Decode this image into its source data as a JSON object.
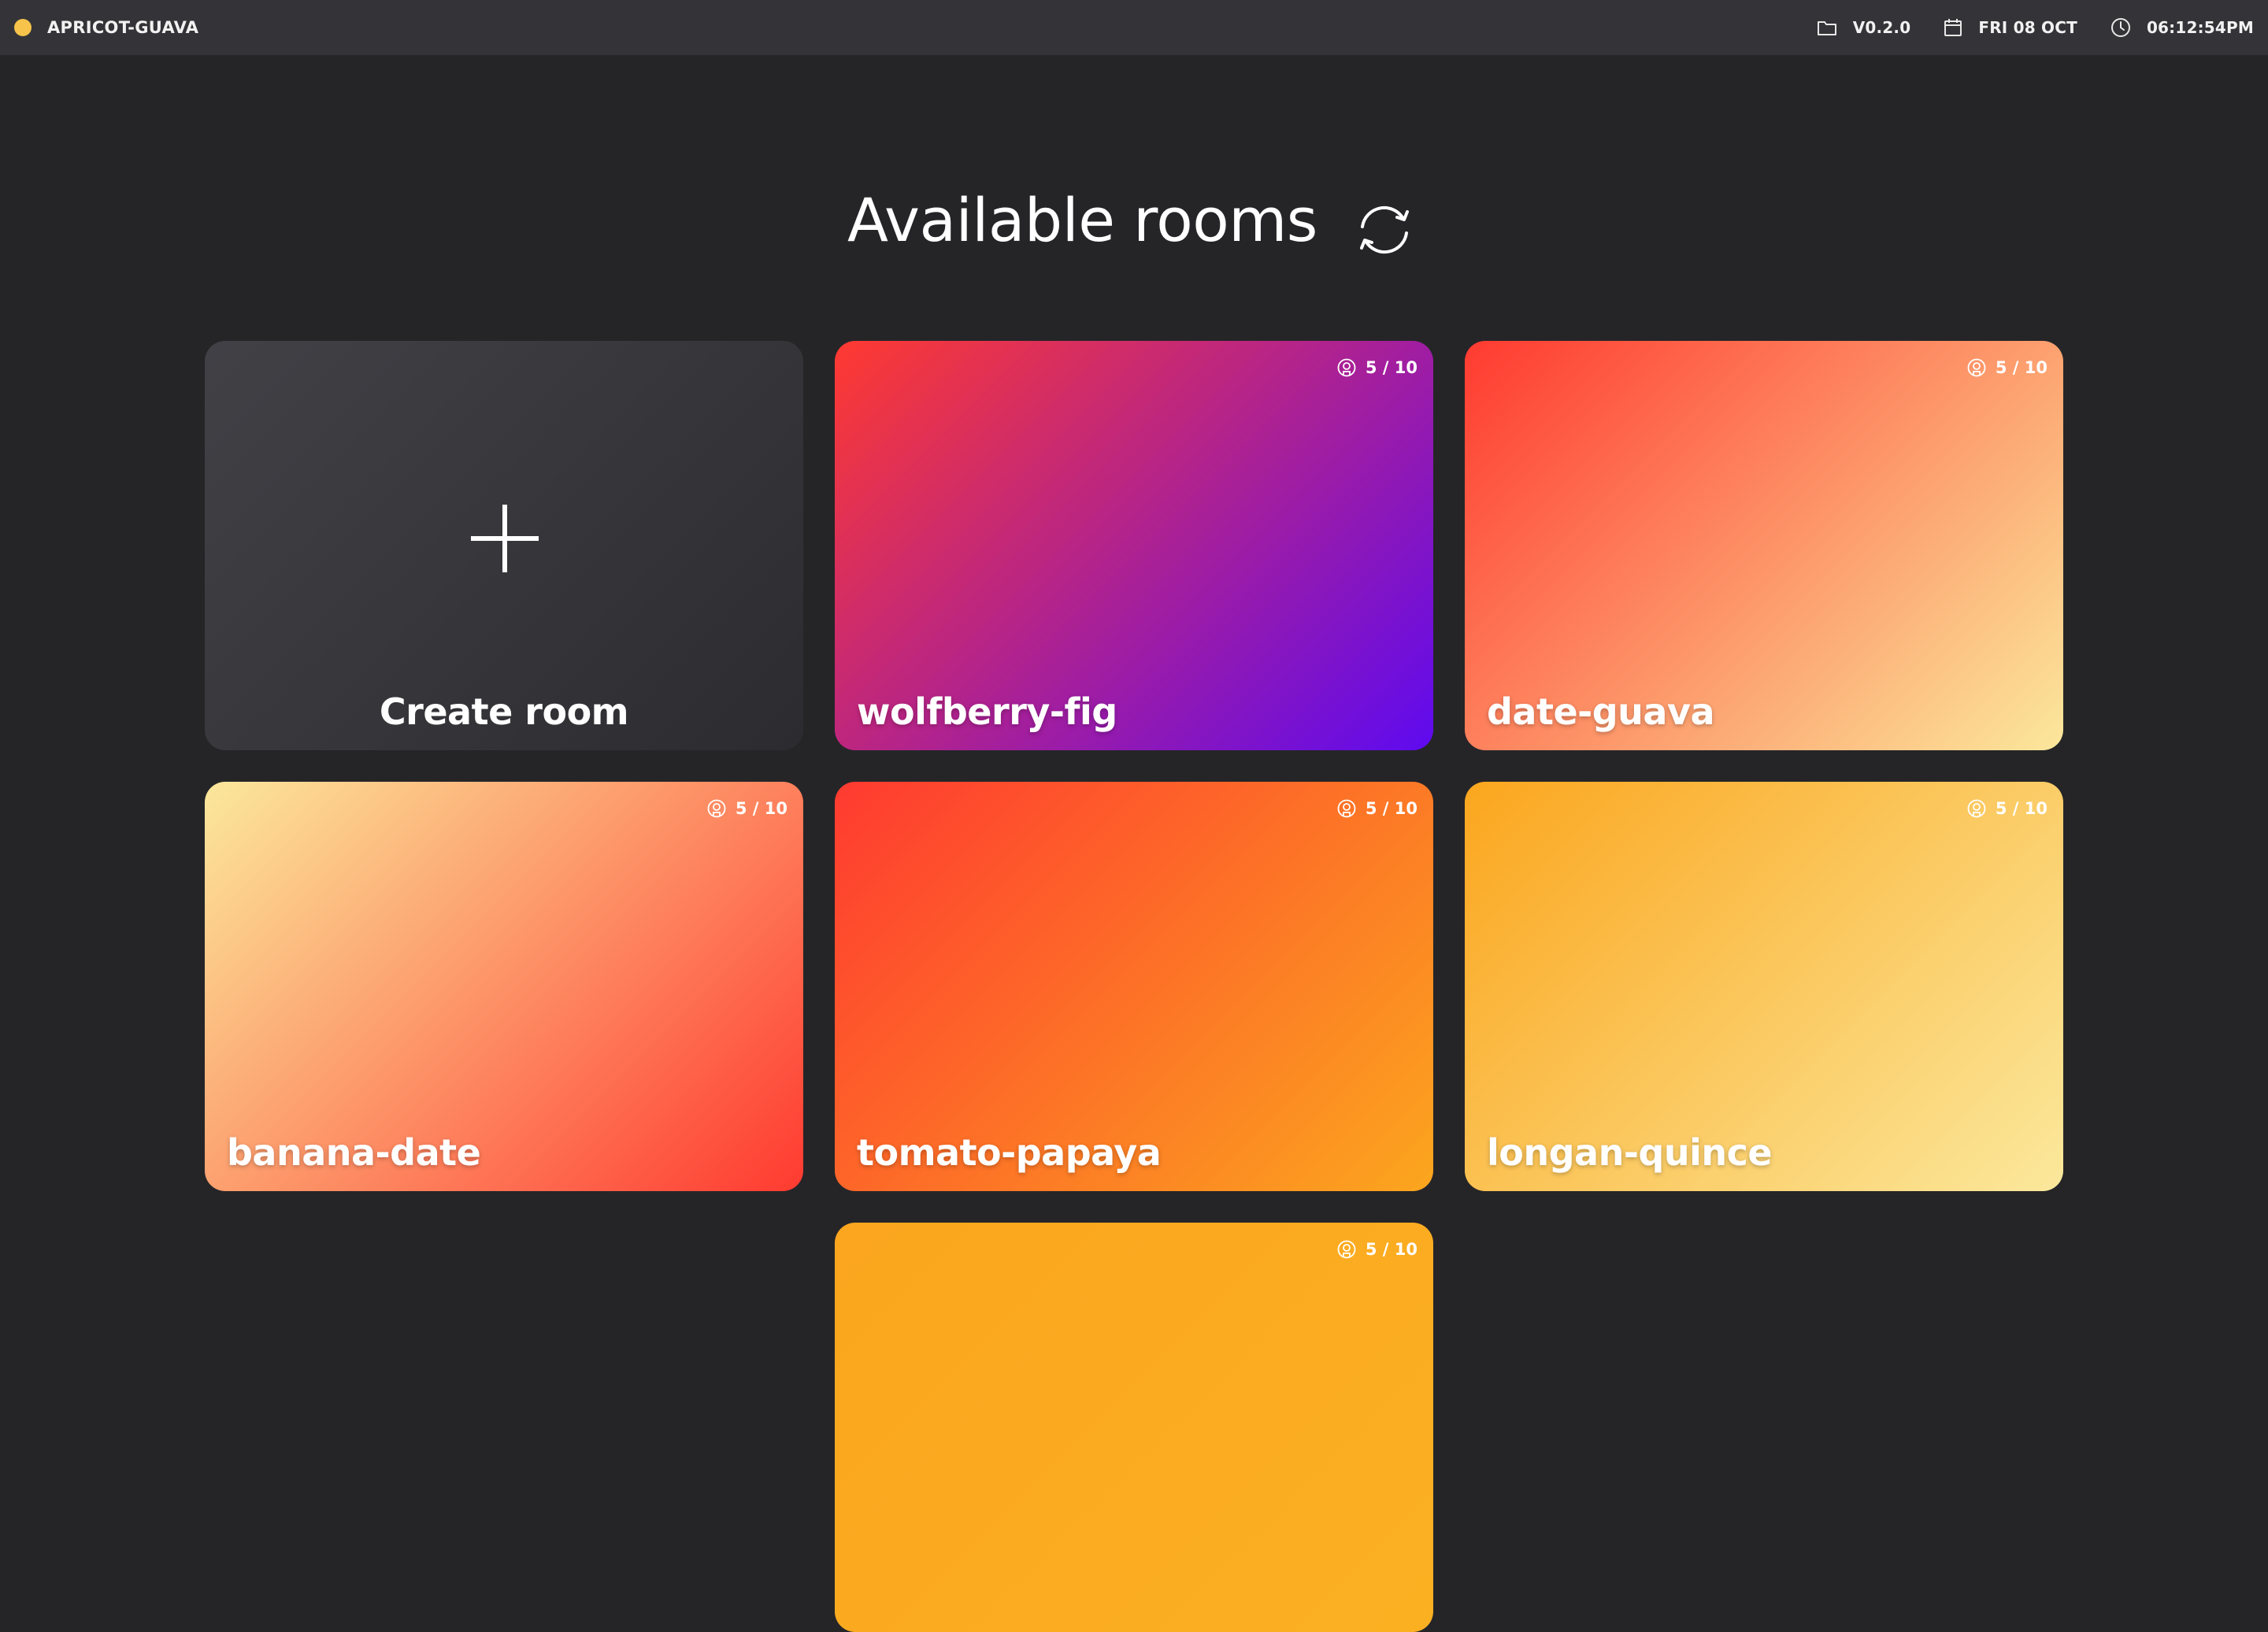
{
  "topbar": {
    "app_name": "APRICOT-GUAVA",
    "status_color": "#f7c34a",
    "version": "V0.2.0",
    "date": "FRI 08 OCT",
    "time": "06:12:54PM",
    "icons": [
      "folder-icon",
      "calendar-icon",
      "clock-icon"
    ]
  },
  "main": {
    "title": "Available rooms",
    "refresh_icon": "refresh-icon"
  },
  "create_card": {
    "label": "Create room",
    "icon": "plus-icon"
  },
  "rooms": [
    {
      "name": "wolfberry-fig",
      "occupancy": "5 / 10",
      "colors": [
        "#ff3a30",
        "#5e0af0"
      ]
    },
    {
      "name": "date-guava",
      "occupancy": "5 / 10",
      "colors": [
        "#ff3a30",
        "#fbe89c"
      ]
    },
    {
      "name": "banana-date",
      "occupancy": "5 / 10",
      "colors": [
        "#fbe89c",
        "#ff3a30"
      ]
    },
    {
      "name": "tomato-papaya",
      "occupancy": "5 / 10",
      "colors": [
        "#ff3a30",
        "#fba61e"
      ]
    },
    {
      "name": "longan-quince",
      "occupancy": "5 / 10",
      "colors": [
        "#fba61e",
        "#fbe89c"
      ]
    },
    {
      "name": "",
      "occupancy": "5 / 10",
      "colors": [
        "#fba61e",
        "#fbb022"
      ]
    }
  ]
}
